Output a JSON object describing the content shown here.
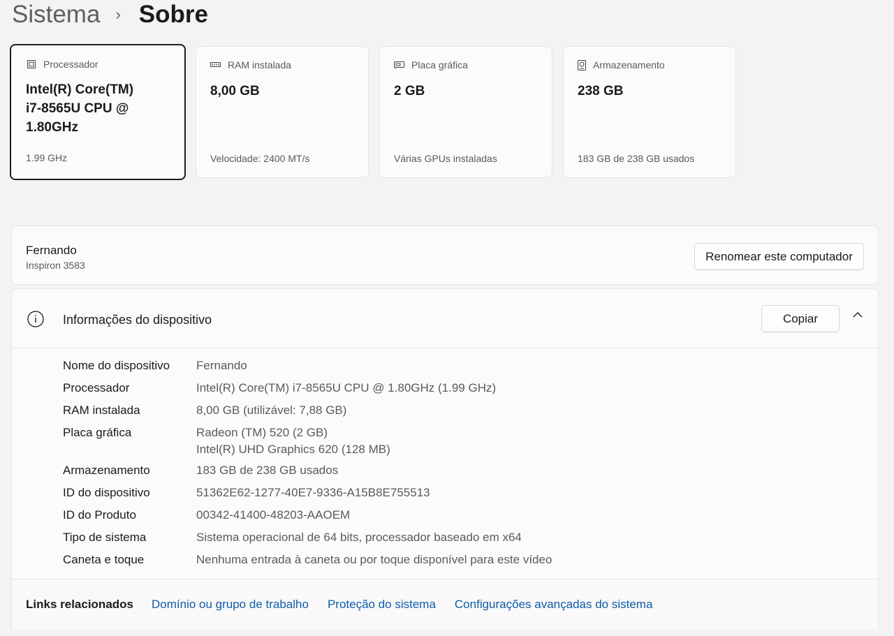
{
  "breadcrumb": {
    "parent": "Sistema",
    "separator": "›",
    "current": "Sobre"
  },
  "cards": [
    {
      "label": "Processador",
      "value": "Intel(R) Core(TM) i7-8565U CPU @ 1.80GHz",
      "footer": "1.99 GHz",
      "icon": "processor-icon"
    },
    {
      "label": "RAM instalada",
      "value": "8,00 GB",
      "footer": "Velocidade: 2400 MT/s",
      "icon": "ram-icon"
    },
    {
      "label": "Placa gráfica",
      "value": "2 GB",
      "footer": "Várias GPUs instaladas",
      "icon": "gpu-icon"
    },
    {
      "label": "Armazenamento",
      "value": "238 GB",
      "footer": "183 GB de 238 GB usados",
      "icon": "storage-icon"
    }
  ],
  "computer": {
    "name": "Fernando",
    "model": "Inspiron 3583",
    "rename_label": "Renomear este computador"
  },
  "device_info": {
    "title": "Informações do dispositivo",
    "copy_label": "Copiar",
    "specs": [
      {
        "label": "Nome do dispositivo",
        "value": "Fernando"
      },
      {
        "label": "Processador",
        "value": "Intel(R) Core(TM) i7-8565U CPU @ 1.80GHz (1.99 GHz)"
      },
      {
        "label": "RAM instalada",
        "value": "8,00 GB (utilizável: 7,88 GB)"
      },
      {
        "label": "Placa gráfica",
        "value": "Radeon (TM) 520 (2 GB)",
        "value2": "Intel(R) UHD Graphics 620 (128 MB)"
      },
      {
        "label": "Armazenamento",
        "value": "183 GB de 238 GB usados"
      },
      {
        "label": "ID do dispositivo",
        "value": "51362E62-1277-40E7-9336-A15B8E755513"
      },
      {
        "label": "ID do Produto",
        "value": "00342-41400-48203-AAOEM"
      },
      {
        "label": "Tipo de sistema",
        "value": "Sistema operacional de 64 bits, processador baseado em x64"
      },
      {
        "label": "Caneta e toque",
        "value": "Nenhuma entrada à caneta ou por toque disponível para este vídeo"
      }
    ]
  },
  "related_links": {
    "label": "Links relacionados",
    "links": [
      "Domínio ou grupo de trabalho",
      "Proteção do sistema",
      "Configurações avançadas do sistema"
    ]
  },
  "colors": {
    "link": "#0f5ba8",
    "background": "#f3f3f3",
    "card": "#fbfbfb"
  }
}
